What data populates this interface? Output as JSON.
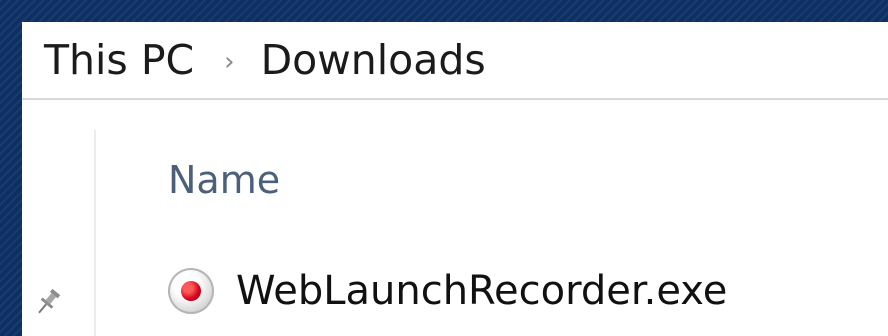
{
  "breadcrumb": {
    "items": [
      "This PC",
      "Downloads"
    ],
    "separator": "›"
  },
  "file_list": {
    "column_header": "Name",
    "files": [
      {
        "name": "WebLaunchRecorder.exe",
        "icon": "record-icon"
      }
    ]
  },
  "quick_access": {
    "pin_icon": "pin-icon"
  },
  "colors": {
    "desktop_bg": "#0d2f63",
    "header_text": "#4c607a",
    "record_red": "#d4001a"
  }
}
